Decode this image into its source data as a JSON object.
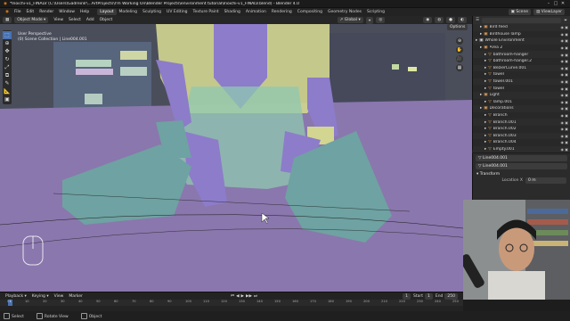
{
  "window": {
    "title": "*Inoichi-v1_FINALV (C:\\Users\\Gadreinlr\\...ArtProjects\\I'm Working On\\Blender Projects\\environment tutorial\\Inoichi-v1_FINALV.blend) - Blender 4.0"
  },
  "menu": {
    "items": [
      "File",
      "Edit",
      "Render",
      "Window",
      "Help"
    ],
    "workspaces": [
      "Layout",
      "Modeling",
      "Sculpting",
      "UV Editing",
      "Texture Paint",
      "Shading",
      "Animation",
      "Rendering",
      "Compositing",
      "Geometry Nodes",
      "Scripting"
    ],
    "active_workspace": "Layout",
    "scene": "Scene",
    "view_layer": "ViewLayer"
  },
  "viewport_header": {
    "mode": "Object Mode",
    "menus": [
      "View",
      "Select",
      "Add",
      "Object"
    ],
    "transform_orientation": "Global",
    "options": "Options"
  },
  "viewport_overlay": {
    "view_name": "User Perspective",
    "collection": "(0) Scene Collection | Line004.001"
  },
  "toolshelf": [
    "cursor-select",
    "move",
    "rotate",
    "scale",
    "transform",
    "annotate",
    "measure",
    "add-cube"
  ],
  "outliner": {
    "search_placeholder": "",
    "items": [
      {
        "label": "Bird feed",
        "indent": 1
      },
      {
        "label": "Birdhouse lamp",
        "indent": 1
      },
      {
        "label": "Whole Environment",
        "indent": 0
      },
      {
        "label": "Area 2",
        "indent": 1
      },
      {
        "label": "bathroom-hanger",
        "indent": 2
      },
      {
        "label": "bathroom-hanger.2",
        "indent": 2
      },
      {
        "label": "BezierCurve.001",
        "indent": 2
      },
      {
        "label": "towel",
        "indent": 2
      },
      {
        "label": "towel.001",
        "indent": 2
      },
      {
        "label": "towel",
        "indent": 2
      },
      {
        "label": "Light",
        "indent": 1
      },
      {
        "label": "lamp.001",
        "indent": 2
      },
      {
        "label": "Decorations",
        "indent": 1
      },
      {
        "label": "Branch",
        "indent": 2
      },
      {
        "label": "Branch.001",
        "indent": 2
      },
      {
        "label": "Branch.002",
        "indent": 2
      },
      {
        "label": "Branch.003",
        "indent": 2
      },
      {
        "label": "Branch.004",
        "indent": 2
      },
      {
        "label": "Empty.001",
        "indent": 2
      },
      {
        "label": "Empty.002",
        "indent": 2
      },
      {
        "label": "Line011",
        "indent": 2
      }
    ]
  },
  "properties": {
    "object_name": "Line004.001",
    "data_name": "Line004.001",
    "section": "Transform",
    "location_label": "Location X",
    "location_value": "0 m"
  },
  "timeline": {
    "menus": [
      "Playback",
      "Keying",
      "View",
      "Marker"
    ],
    "current_frame": "1",
    "start_label": "Start",
    "start_value": "1",
    "end_label": "End",
    "end_value": "250",
    "ticks": [
      "0",
      "10",
      "20",
      "30",
      "40",
      "50",
      "60",
      "70",
      "80",
      "90",
      "100",
      "110",
      "120",
      "130",
      "140",
      "150",
      "160",
      "170",
      "180",
      "190",
      "200",
      "210",
      "220",
      "230",
      "240",
      "250"
    ]
  },
  "statusbar": {
    "items": [
      "Select",
      "Rotate View",
      "Object"
    ]
  },
  "colors": {
    "accent": "#4772b3",
    "viewport_bg": "#3e4150",
    "floor": "#8a77ad",
    "character_teal": "#6fa2a2",
    "character_yellow": "#d3d690"
  }
}
